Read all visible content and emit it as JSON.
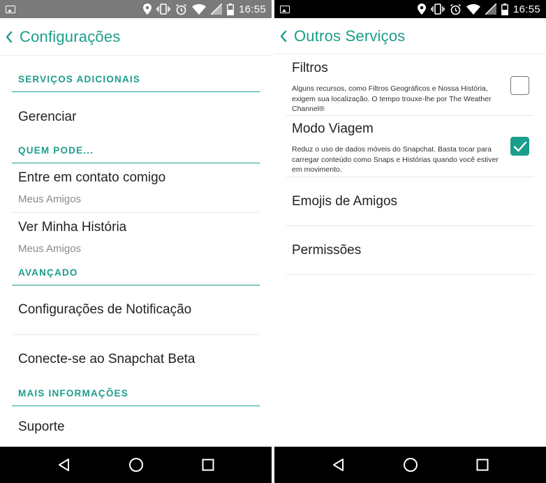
{
  "colors": {
    "accent": "#1b9e8b",
    "statusbar_left": "#7a7a7a",
    "statusbar_right": "#000000",
    "navbar": "#000000"
  },
  "status": {
    "time": "16:55",
    "icons": [
      "image-icon",
      "location-icon",
      "vibrate-icon",
      "alarm-icon",
      "wifi-icon",
      "signal-icon",
      "battery-icon"
    ]
  },
  "left": {
    "title": "Configurações",
    "sections": [
      {
        "header": "SERVIÇOS ADICIONAIS",
        "items": [
          {
            "title": "Gerenciar"
          }
        ]
      },
      {
        "header": "QUEM PODE...",
        "items": [
          {
            "title": "Entre em contato comigo",
            "subtitle": "Meus Amigos"
          },
          {
            "title": "Ver Minha História",
            "subtitle": "Meus Amigos"
          }
        ]
      },
      {
        "header": "AVANÇADO",
        "items": [
          {
            "title": "Configurações de Notificação"
          },
          {
            "title": "Conecte-se ao Snapchat Beta"
          }
        ]
      },
      {
        "header": "MAIS INFORMAÇÕES",
        "items": [
          {
            "title": "Suporte"
          }
        ]
      }
    ]
  },
  "right": {
    "title": "Outros Serviços",
    "options": [
      {
        "title": "Filtros",
        "description": "Alguns recursos, como Filtros Geográficos e Nossa História, exigem sua localização. O tempo trouxe-lhe por The Weather Channel®",
        "checked": false
      },
      {
        "title": "Modo Viagem",
        "description": "Reduz o uso de dados móveis do Snapchat. Basta tocar para carregar conteúdo como Snaps e Histórias quando você estiver em movimento.",
        "checked": true
      }
    ],
    "items": [
      {
        "title": "Emojis de Amigos"
      },
      {
        "title": "Permissões"
      }
    ]
  },
  "nav": {
    "icons": [
      "back-triangle-icon",
      "home-circle-icon",
      "recents-square-icon"
    ]
  }
}
